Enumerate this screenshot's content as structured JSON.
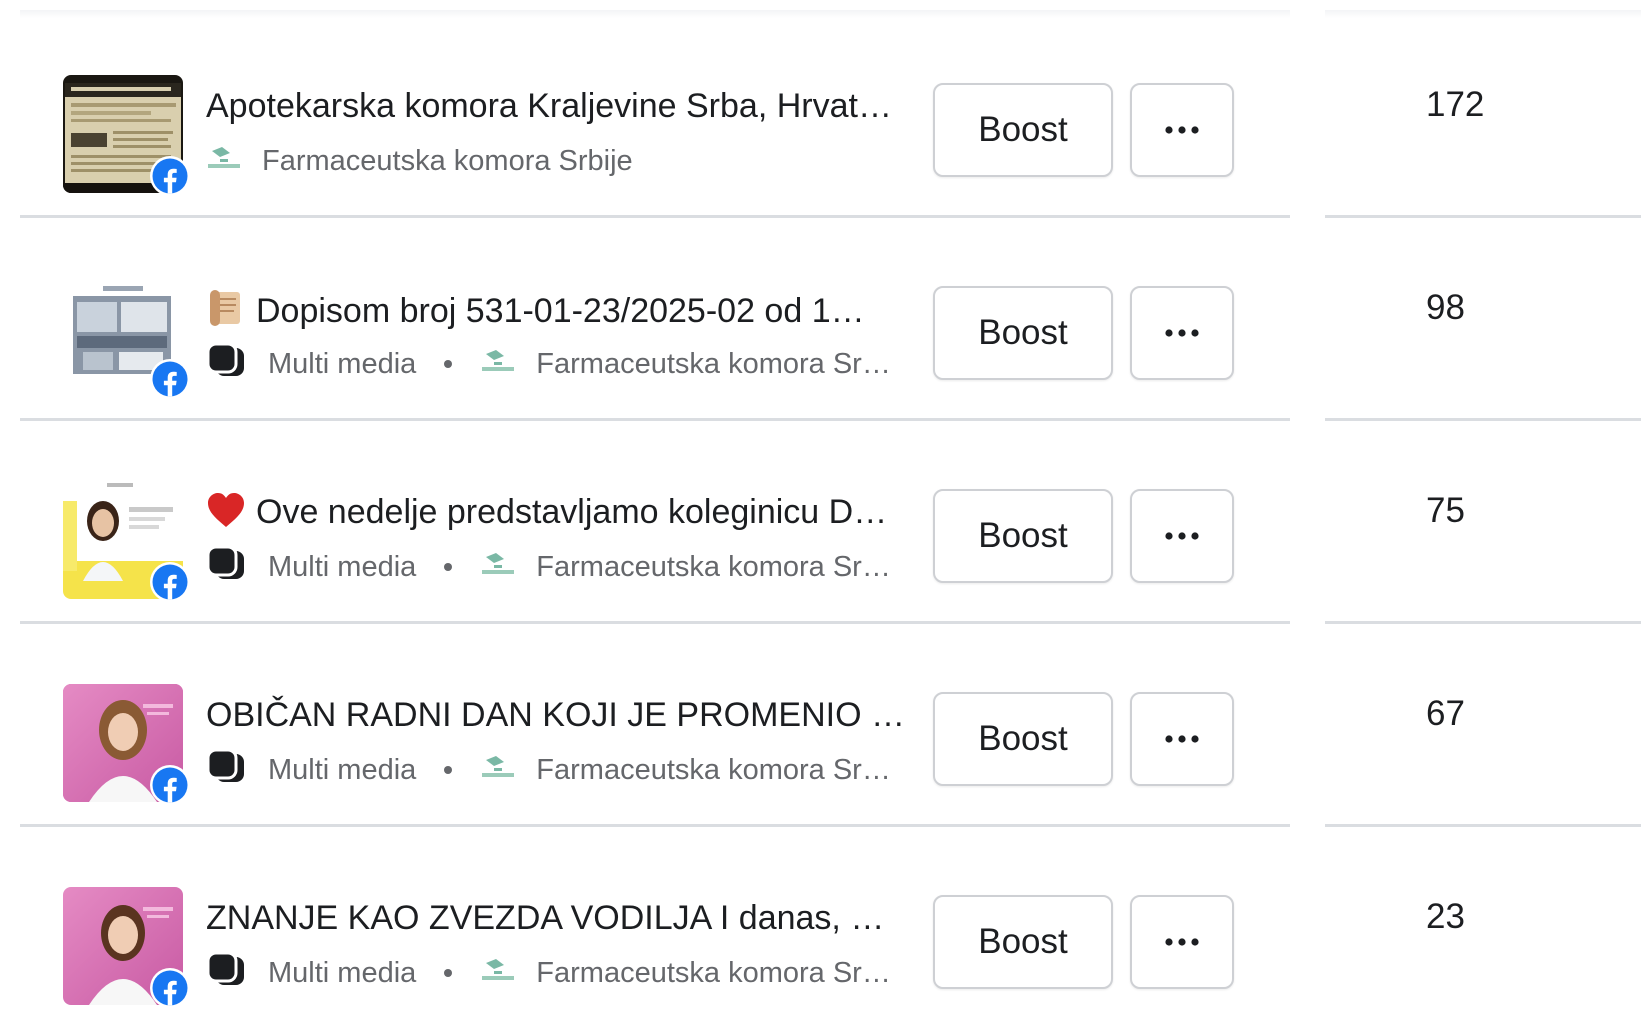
{
  "colors": {
    "facebook_blue": "#1877f2",
    "text_primary": "#1c1e21",
    "text_secondary": "#65676b",
    "divider": "#dadde1",
    "button_border": "#ced0d4"
  },
  "posts": [
    {
      "title": "Apotekarska komora Kraljevine Srba, Hrvat…",
      "title_icon": "",
      "post_type": "",
      "page_name": "Farmaceutska komora Srbije",
      "boost_label": "Boost",
      "metric": "172",
      "thumbnail": "newspaper-clipping-thumbnail",
      "platform_icon": "facebook-icon"
    },
    {
      "title": "Dopisom broj 531-01-23/2025-02 od 1…",
      "title_icon": "scroll-icon",
      "post_type": "Multi media",
      "page_name": "Farmaceutska komora Sr…",
      "boost_label": "Boost",
      "metric": "98",
      "thumbnail": "document-photo-thumbnail",
      "platform_icon": "facebook-icon"
    },
    {
      "title": "Ove nedelje predstavljamo koleginicu D…",
      "title_icon": "red-heart-icon",
      "post_type": "Multi media",
      "page_name": "Farmaceutska komora Sr…",
      "boost_label": "Boost",
      "metric": "75",
      "thumbnail": "pharmacist-portrait-yellow-thumbnail",
      "platform_icon": "facebook-icon"
    },
    {
      "title": "OBIČAN RADNI DAN KOJI JE PROMENIO …",
      "title_icon": "",
      "post_type": "Multi media",
      "page_name": "Farmaceutska komora Sr…",
      "boost_label": "Boost",
      "metric": "67",
      "thumbnail": "pharmacist-portrait-pink-thumbnail",
      "platform_icon": "facebook-icon"
    },
    {
      "title": "ZNANJE KAO ZVEZDA VODILJA I danas, …",
      "title_icon": "",
      "post_type": "Multi media",
      "page_name": "Farmaceutska komora Sr…",
      "boost_label": "Boost",
      "metric": "23",
      "thumbnail": "pharmacist-portrait-pink-thumbnail",
      "platform_icon": "facebook-icon"
    }
  ]
}
